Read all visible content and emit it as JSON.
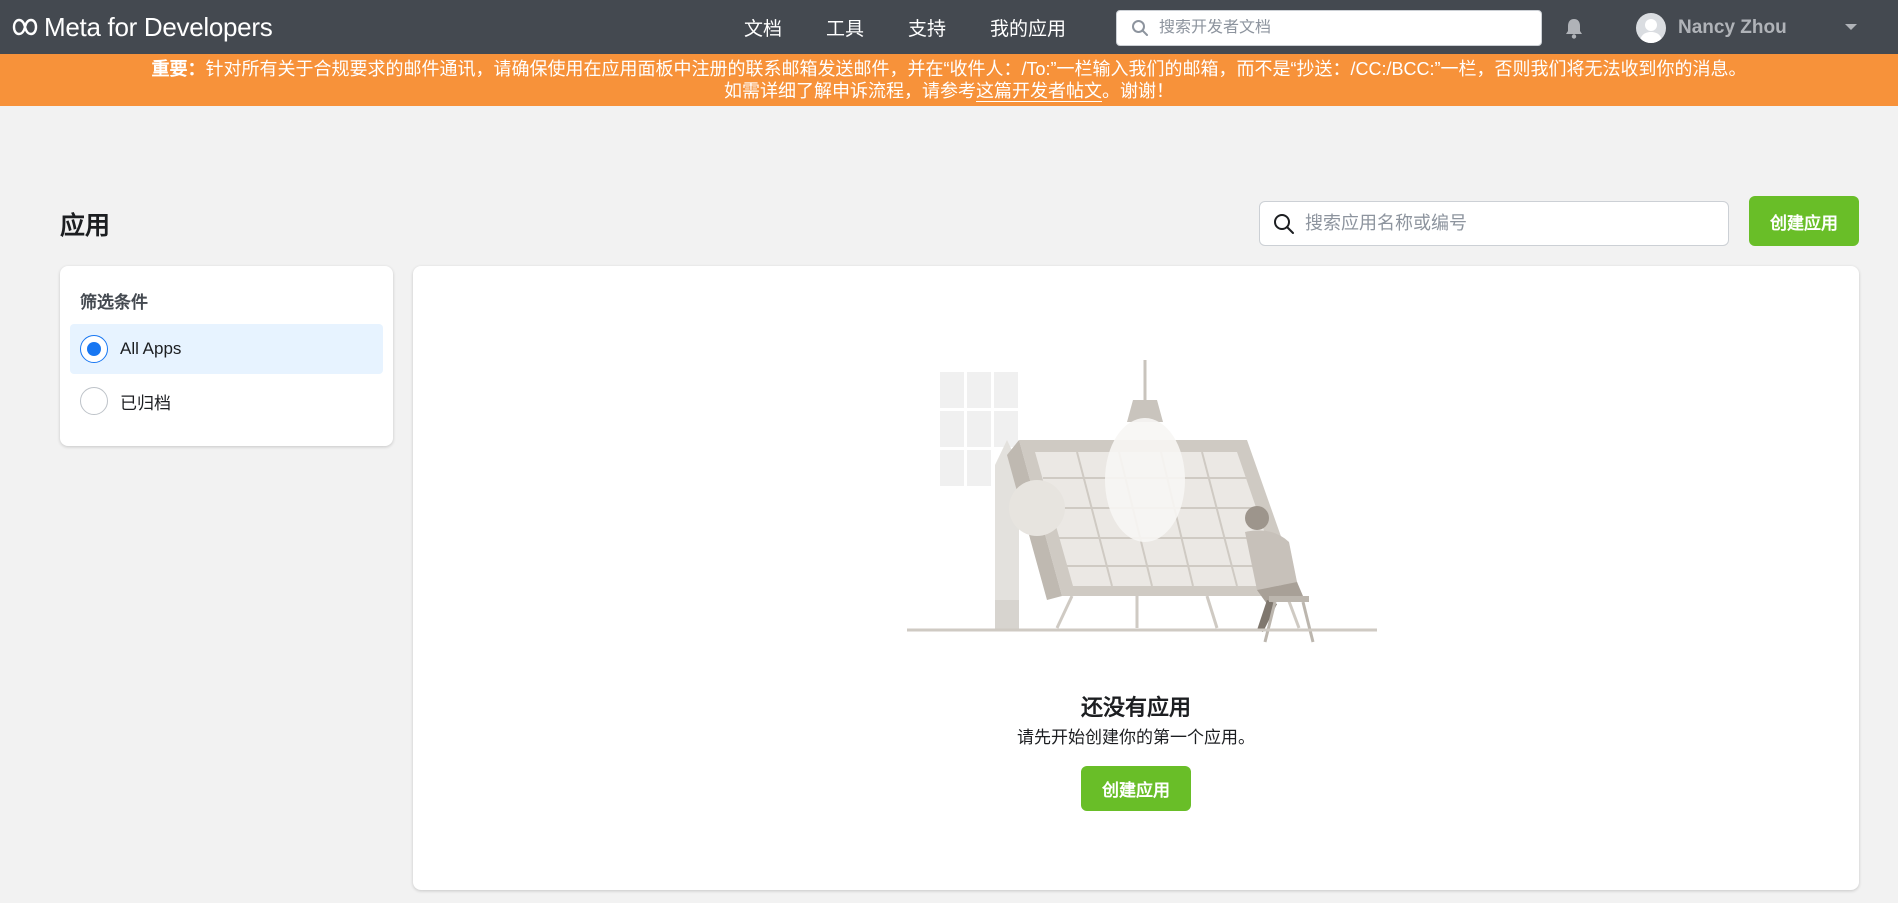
{
  "brand": {
    "name": "Meta for Developers"
  },
  "nav": {
    "links": [
      "文档",
      "工具",
      "支持",
      "我的应用"
    ],
    "search_placeholder": "搜索开发者文档"
  },
  "user": {
    "name": "Nancy Zhou"
  },
  "notice": {
    "lead": "重要：",
    "line1": "针对所有关于合规要求的邮件通讯，请确保使用在应用面板中注册的联系邮箱发送邮件，并在“收件人：/To:”一栏输入我们的邮箱，而不是“抄送：/CC:/BCC:”一栏，否则我们将无法收到你的消息。",
    "line2_pre": "如需详细了解申诉流程，请参考",
    "line2_link": "这篇开发者帖文",
    "line2_post": "。谢谢！"
  },
  "page": {
    "title": "应用",
    "search_placeholder": "搜索应用名称或编号",
    "create_label": "创建应用"
  },
  "filter": {
    "title": "筛选条件",
    "options": [
      {
        "label": "All Apps",
        "selected": true
      },
      {
        "label": "已归档",
        "selected": false
      }
    ]
  },
  "empty": {
    "title": "还没有应用",
    "subtitle": "请先开始创建你的第一个应用。",
    "create_label": "创建应用"
  },
  "colors": {
    "nav_bg": "#444950",
    "notice_bg": "#f7923a",
    "accent_green": "#69be28",
    "selected_bg": "#e7f3ff",
    "radio_blue": "#1877f2"
  }
}
